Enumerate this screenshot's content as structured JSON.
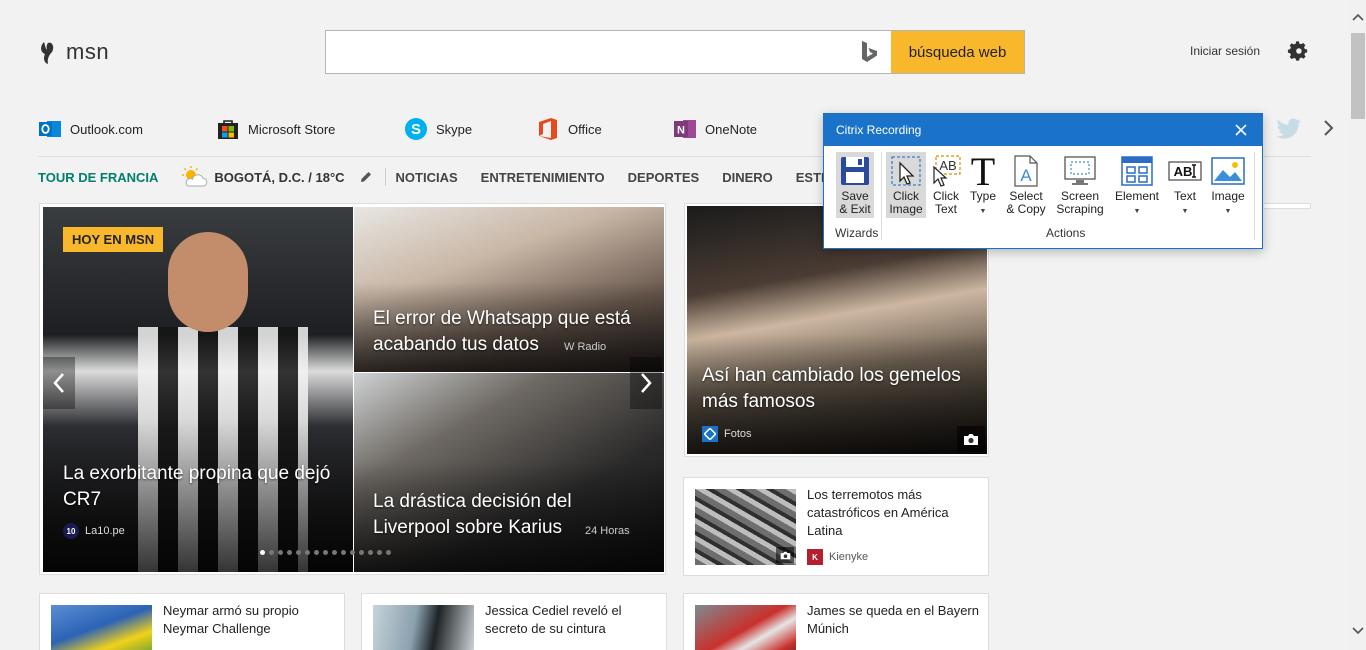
{
  "header": {
    "logo_text": "msn",
    "search_placeholder": "",
    "search_button": "búsqueda web",
    "signin": "Iniciar sesión"
  },
  "apps": [
    {
      "label": "Outlook.com",
      "icon": "outlook-icon",
      "color": "#0072c6"
    },
    {
      "label": "Microsoft Store",
      "icon": "store-icon",
      "color": "#333333"
    },
    {
      "label": "Skype",
      "icon": "skype-icon",
      "color": "#00aff0"
    },
    {
      "label": "Office",
      "icon": "office-icon",
      "color": "#e64a19"
    },
    {
      "label": "OneNote",
      "icon": "onenote-icon",
      "color": "#80397b"
    }
  ],
  "nav": {
    "tour": "TOUR DE FRANCIA",
    "weather": "BOGOTÁ, D.C. / 18°C",
    "items": [
      "NOTICIAS",
      "ENTRETENIMIENTO",
      "DEPORTES",
      "DINERO",
      "ESTILO DE V"
    ]
  },
  "hero": {
    "badge": "HOY EN MSN",
    "main": {
      "title": "La exorbitante propina que dejó CR7",
      "source": "La10.pe",
      "source_logo": "10"
    },
    "top": {
      "title": "El error de Whatsapp que está acabando tus datos",
      "source": "W Radio"
    },
    "bottom": {
      "title": "La drástica decisión del Liverpool sobre Karius",
      "source": "24 Horas"
    },
    "dot_count": 15,
    "active_dot": 1
  },
  "right_card": {
    "title": "Así han cambiado los gemelos más famosos",
    "source": "Fotos"
  },
  "quake_card": {
    "title": "Los terremotos más catastróficos en América Latina",
    "source": "Kienyke",
    "source_logo": "K"
  },
  "bottom_cards": [
    {
      "title": "Neymar armó su propio Neymar Challenge"
    },
    {
      "title": "Jessica Cediel reveló el secreto de su cintura"
    },
    {
      "title": "James se queda en el Bayern Múnich"
    }
  ],
  "citrix": {
    "title": "Citrix Recording",
    "buttons": {
      "save_exit": "Save & Exit",
      "click_image": "Click Image",
      "click_text": "Click Text",
      "type": "Type",
      "select_copy": "Select & Copy",
      "screen_scraping": "Screen Scraping",
      "element": "Element",
      "text": "Text",
      "image": "Image"
    },
    "groups": {
      "wizards": "Wizards",
      "actions": "Actions"
    },
    "accent": "#1a73c9"
  },
  "colors": {
    "search_button": "#f9b72b",
    "tour_link": "#00806b"
  }
}
